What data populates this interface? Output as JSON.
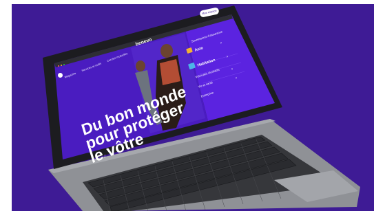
{
  "site": {
    "brand": "benevo",
    "nav": [
      "Magazine",
      "Services et outils",
      "Cercles mutuelles"
    ],
    "cta": "Mon espace",
    "hero_lines": [
      "Du bon monde",
      "pour protéger",
      "le vôtre"
    ],
    "hero_arrow": "↓",
    "menu_heading": "Soumissions d'assurance",
    "menu_items": [
      {
        "label": "Auto",
        "icon": "car-icon"
      },
      {
        "label": "Habitation",
        "icon": "house-icon"
      }
    ],
    "menu_links": [
      "Véhicules récréatifs",
      "Vie et santé",
      "Entreprise"
    ],
    "menu_arrow": "›"
  },
  "colors": {
    "background": "#3e1b95",
    "screen_left": "#4a1cc0",
    "screen_right": "#5b23e0",
    "laptop_body": "#8c8e94",
    "keyboard": "#2b2c30"
  }
}
